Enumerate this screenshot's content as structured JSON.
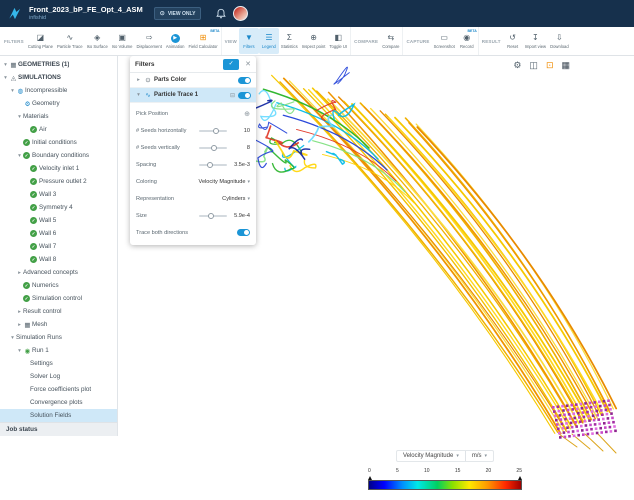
{
  "header": {
    "project_title": "Front_2023_bP_FE_Opt_4_ASM",
    "project_subtitle": "infishid",
    "view_only_label": "VIEW ONLY"
  },
  "toolbar": {
    "groups": [
      {
        "label": "FILTERS",
        "items": [
          {
            "label": "Cutting Plane",
            "icon": "cutting-plane"
          },
          {
            "label": "Particle Trace",
            "icon": "particle-trace"
          },
          {
            "label": "Iso Surface",
            "icon": "iso-surface"
          },
          {
            "label": "Iso Volume",
            "icon": "iso-volume"
          },
          {
            "label": "Displacement",
            "icon": "displacement"
          },
          {
            "label": "Animation",
            "icon": "animation",
            "style": "round-blue"
          },
          {
            "label": "Field Calculator",
            "icon": "field-calculator",
            "badge": "BETA",
            "color": "#f08b00"
          }
        ]
      },
      {
        "label": "VIEW",
        "items": [
          {
            "label": "Filters",
            "icon": "filters",
            "active": true
          },
          {
            "label": "Legend",
            "icon": "legend",
            "active": true
          },
          {
            "label": "Statistics",
            "icon": "statistics"
          },
          {
            "label": "Inspect point",
            "icon": "inspect-point"
          },
          {
            "label": "Toggle UI",
            "icon": "toggle-ui"
          }
        ]
      },
      {
        "label": "COMPARE",
        "items": [
          {
            "label": "Compare",
            "icon": "compare"
          }
        ]
      },
      {
        "label": "CAPTURE",
        "items": [
          {
            "label": "Screenshot",
            "icon": "screenshot"
          },
          {
            "label": "Record",
            "icon": "record",
            "badge": "BETA"
          }
        ]
      },
      {
        "label": "RESULT",
        "items": [
          {
            "label": "Reset",
            "icon": "reset"
          },
          {
            "label": "Import view",
            "icon": "import-view"
          },
          {
            "label": "Download",
            "icon": "download"
          }
        ]
      }
    ]
  },
  "sidebar": {
    "items": [
      {
        "label": "GEOMETRIES (1)",
        "indent": 0,
        "caret": "down",
        "icon": "geometry-cube",
        "bold": true
      },
      {
        "label": "SIMULATIONS",
        "indent": 0,
        "caret": "down",
        "icon": "flask",
        "bold": true
      },
      {
        "label": "Incompressible",
        "indent": 1,
        "caret": "down",
        "icon": "fluid"
      },
      {
        "label": "Geometry",
        "indent": 2,
        "icon": "gear"
      },
      {
        "label": "Materials",
        "indent": 2,
        "caret": "down"
      },
      {
        "label": "Air",
        "indent": 3,
        "icon": "check"
      },
      {
        "label": "Initial conditions",
        "indent": 2,
        "icon": "check"
      },
      {
        "label": "Boundary conditions",
        "indent": 2,
        "caret": "down",
        "icon": "check"
      },
      {
        "label": "Velocity inlet 1",
        "indent": 3,
        "icon": "check"
      },
      {
        "label": "Pressure outlet 2",
        "indent": 3,
        "icon": "check"
      },
      {
        "label": "Wall 3",
        "indent": 3,
        "icon": "check"
      },
      {
        "label": "Symmetry 4",
        "indent": 3,
        "icon": "check"
      },
      {
        "label": "Wall 5",
        "indent": 3,
        "icon": "check"
      },
      {
        "label": "Wall 6",
        "indent": 3,
        "icon": "check"
      },
      {
        "label": "Wall 7",
        "indent": 3,
        "icon": "check"
      },
      {
        "label": "Wall 8",
        "indent": 3,
        "icon": "check"
      },
      {
        "label": "Advanced concepts",
        "indent": 2,
        "caret": "right"
      },
      {
        "label": "Numerics",
        "indent": 2,
        "icon": "check"
      },
      {
        "label": "Simulation control",
        "indent": 2,
        "icon": "check"
      },
      {
        "label": "Result control",
        "indent": 2,
        "caret": "right"
      },
      {
        "label": "Mesh",
        "indent": 2,
        "caret": "right",
        "icon": "mesh"
      },
      {
        "label": "Simulation Runs",
        "indent": 1,
        "caret": "down"
      },
      {
        "label": "Run 1",
        "indent": 2,
        "caret": "down",
        "icon": "run"
      },
      {
        "label": "Settings",
        "indent": 3
      },
      {
        "label": "Solver Log",
        "indent": 3
      },
      {
        "label": "Force coefficients plot",
        "indent": 3
      },
      {
        "label": "Convergence plots",
        "indent": 3
      },
      {
        "label": "Solution Fields",
        "indent": 3,
        "selected": true
      }
    ],
    "job_status": "Job status"
  },
  "filters_panel": {
    "title": "Filters",
    "rows": [
      {
        "label": "Parts Color",
        "icon": "eye",
        "caret": "right",
        "toggle": true
      },
      {
        "label": "Particle Trace 1",
        "icon": "trace",
        "caret": "down",
        "toggle": true,
        "selected": true,
        "deletable": true
      }
    ],
    "fields": [
      {
        "label": "Pick Position",
        "type": "action",
        "icon": "crosshair"
      },
      {
        "label": "# Seeds horizontally",
        "type": "slider",
        "value": "10",
        "pos": 0.6
      },
      {
        "label": "# Seeds vertically",
        "type": "slider",
        "value": "8",
        "pos": 0.55
      },
      {
        "label": "Spacing",
        "type": "slider",
        "value": "3.5e-3",
        "pos": 0.38
      },
      {
        "label": "Coloring",
        "type": "select",
        "value": "Velocity Magnitude"
      },
      {
        "label": "Representation",
        "type": "select",
        "value": "Cylinders"
      },
      {
        "label": "Size",
        "type": "slider",
        "value": "5.9e-4",
        "pos": 0.42
      },
      {
        "label": "Trace both directions",
        "type": "toggle",
        "value": true
      }
    ]
  },
  "viewport": {
    "tools": [
      {
        "name": "settings",
        "icon": "gear"
      },
      {
        "name": "view-cube",
        "icon": "cube"
      },
      {
        "name": "highlight-parts",
        "icon": "parts",
        "color": "#f08b00"
      },
      {
        "name": "layout-views",
        "icon": "multiview",
        "color": "#3b4753"
      }
    ]
  },
  "legend": {
    "field": "Velocity Magnitude",
    "unit": "m/s",
    "ticks": [
      "0",
      "5",
      "10",
      "15",
      "20",
      "25"
    ],
    "colormap": [
      "#000089",
      "#0000ff",
      "#0090ff",
      "#00e8e8",
      "#00d060",
      "#8ae000",
      "#ffe800",
      "#ff9800",
      "#ff2800",
      "#9e0000"
    ]
  },
  "colors": {
    "accent_blue": "#1b95d6",
    "header_bg": "#16304c",
    "selection_bg": "#cfe8f8",
    "success_green": "#43a047",
    "streamline_gold": "#f3c000",
    "seed_grid_magenta": "#c848c8"
  }
}
